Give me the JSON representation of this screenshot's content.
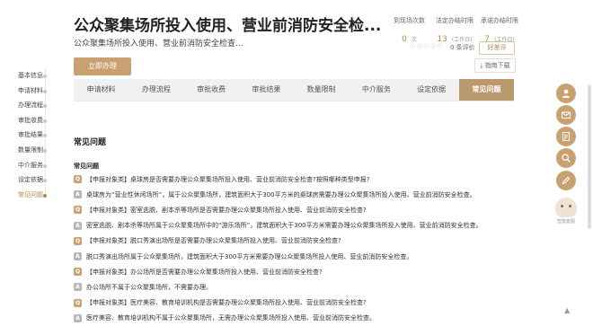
{
  "header": {
    "title": "公众聚集场所投入使用、营业前消防安全检...",
    "subtitle": "公众聚集场所投入使用、营业前消防安全检查..."
  },
  "stats": [
    {
      "label": "到现场次数",
      "value": "0",
      "unit": "次"
    },
    {
      "label": "法定办结时限",
      "value": "13",
      "unit": "(工作日)"
    },
    {
      "label": "承诺办结时限",
      "value": "7",
      "unit": "(工作日)"
    }
  ],
  "rating": {
    "stars": "☆☆☆☆☆",
    "count_label": "0 条评价",
    "eval_button": "好差评"
  },
  "actions": {
    "apply": "立即办理",
    "download": "指南下载"
  },
  "leftnav": {
    "items": [
      {
        "label": "基本信息"
      },
      {
        "label": "申请材料"
      },
      {
        "label": "办理流程"
      },
      {
        "label": "审批收费"
      },
      {
        "label": "审批结果"
      },
      {
        "label": "数量限制"
      },
      {
        "label": "中介服务"
      },
      {
        "label": "设定依据"
      },
      {
        "label": "常见问题"
      }
    ],
    "active_index": 8
  },
  "tabs": [
    {
      "label": "申请材料"
    },
    {
      "label": "办理流程"
    },
    {
      "label": "审批收费"
    },
    {
      "label": "审批结果"
    },
    {
      "label": "数量限制"
    },
    {
      "label": "中介服务"
    },
    {
      "label": "设定依据"
    },
    {
      "label": "常见问题"
    }
  ],
  "active_tab_index": 7,
  "content": {
    "section_title": "常见问题",
    "faq_title": "常见问题"
  },
  "faq": [
    {
      "type": "Q",
      "text": "【申报对象类】桌球房是否需要办理公众聚集场所投入使用、营业前消防安全检查?按照哪种类型申报?"
    },
    {
      "type": "A",
      "text": "桌球房为“营业性休闲场所”，属于公众聚集场所，建筑面积大于300平方米的桌球房需要办理公众聚集场所投入使用、营业前消防安全检查。"
    },
    {
      "type": "Q",
      "text": "【申报对象类】密室逃脱、剧本杀等场所是否需要办理公众聚集场所投入使用、营业前消防安全检查?"
    },
    {
      "type": "A",
      "text": "密室逃脱、剧本杀等场所属于公众聚集场所中的“游乐场所”，建筑面积大于300平方米需要办理公众聚集场所投入使用、营业前消防安全检查。"
    },
    {
      "type": "Q",
      "text": "【申报对象类】脱口秀演出场所是否需要办理公众聚集场所投入使用、营业前消防安全检查?"
    },
    {
      "type": "A",
      "text": "脱口秀演出场所属于公众聚集场所，建筑面积大于300平方米需要办理公众聚集场所投入使用、营业前消防安全检查。"
    },
    {
      "type": "Q",
      "text": "【申报对象类】办公场所是否需要办理公众聚集场所投入使用、营业前消防安全检查?"
    },
    {
      "type": "A",
      "text": "办公场所不属于公众聚集场所，不需要办理。"
    },
    {
      "type": "Q",
      "text": "【申报对象类】医疗美容、教育培训机构是否需要办理公众聚集场所投入使用、营业前消防安全检查?"
    },
    {
      "type": "A",
      "text": "医疗美容、教育培训机构不属于公众聚集场所，无需办理公众聚集场所投入使用、营业前消防安全检查。"
    }
  ],
  "floating": {
    "buttons": [
      {
        "icon": "user-icon"
      },
      {
        "icon": "mail-icon"
      },
      {
        "icon": "document-icon"
      },
      {
        "icon": "search-icon"
      },
      {
        "icon": "edit-icon"
      }
    ],
    "assistant_label": "智能客服"
  },
  "colors": {
    "accent": "#c9a170",
    "accent_dark": "#b99a6e",
    "text": "#333333"
  }
}
